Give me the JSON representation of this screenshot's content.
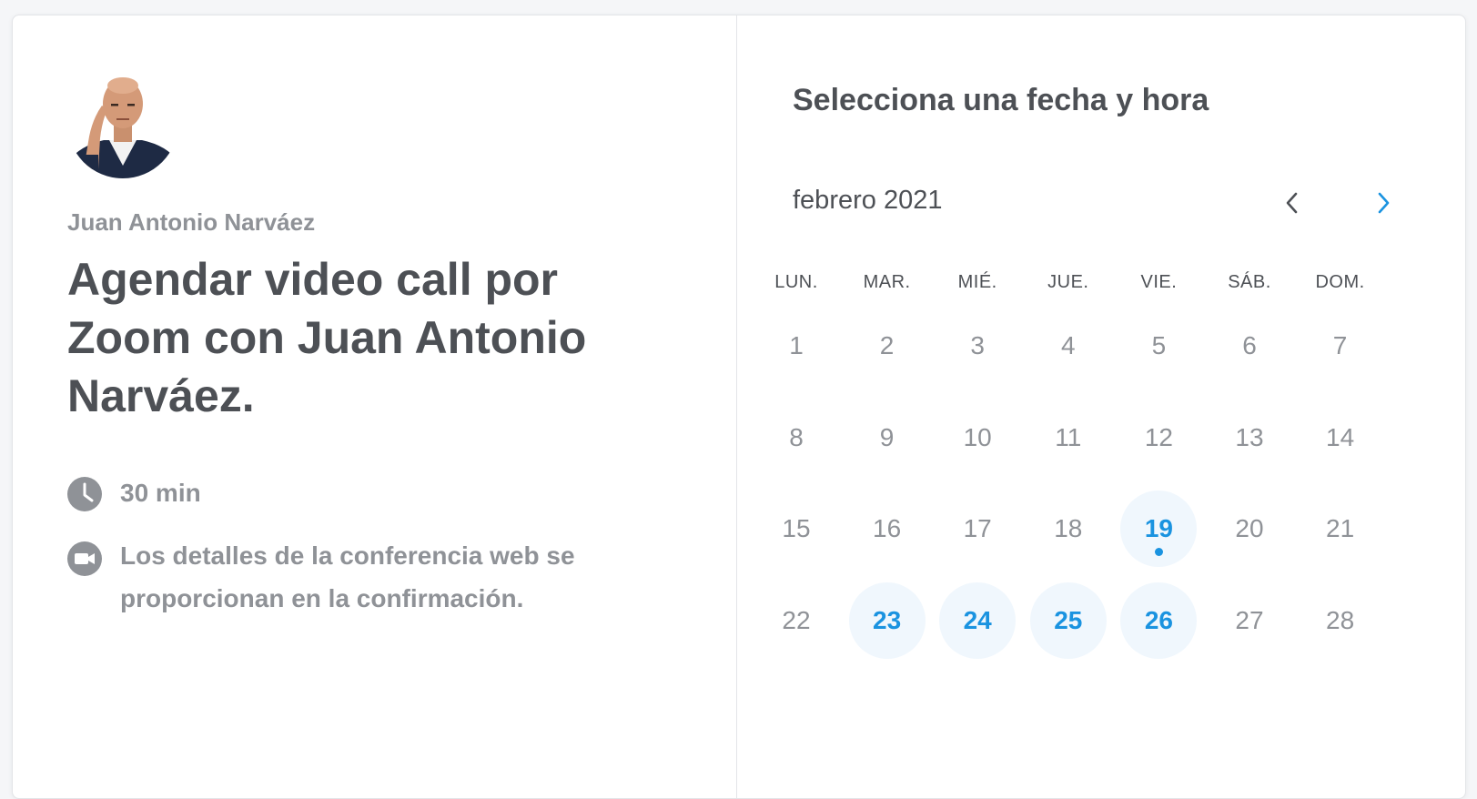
{
  "colors": {
    "accent": "#1a93e0",
    "available_bg": "#f0f7fd",
    "heading": "#4d5055",
    "muted": "#8f9297"
  },
  "host": {
    "name": "Juan Antonio Narváez",
    "avatar": "host-avatar-photo"
  },
  "event": {
    "title": "Agendar video call por Zoom con Juan Antonio Narváez.",
    "duration": "30 min",
    "duration_icon": "clock-icon",
    "conference": "Los detalles de la conferencia web se proporcionan en la confirmación.",
    "conference_icon": "video-camera-icon"
  },
  "picker": {
    "title": "Selecciona una fecha y hora",
    "month": "febrero 2021",
    "prev_icon": "chevron-left-icon",
    "next_icon": "chevron-right-icon",
    "weekdays": [
      "LUN.",
      "MAR.",
      "MIÉ.",
      "JUE.",
      "VIE.",
      "SÁB.",
      "DOM."
    ],
    "days": [
      {
        "label": "1",
        "available": false
      },
      {
        "label": "2",
        "available": false
      },
      {
        "label": "3",
        "available": false
      },
      {
        "label": "4",
        "available": false
      },
      {
        "label": "5",
        "available": false
      },
      {
        "label": "6",
        "available": false
      },
      {
        "label": "7",
        "available": false
      },
      {
        "label": "8",
        "available": false
      },
      {
        "label": "9",
        "available": false
      },
      {
        "label": "10",
        "available": false
      },
      {
        "label": "11",
        "available": false
      },
      {
        "label": "12",
        "available": false
      },
      {
        "label": "13",
        "available": false
      },
      {
        "label": "14",
        "available": false
      },
      {
        "label": "15",
        "available": false
      },
      {
        "label": "16",
        "available": false
      },
      {
        "label": "17",
        "available": false
      },
      {
        "label": "18",
        "available": false
      },
      {
        "label": "19",
        "available": true,
        "today": true
      },
      {
        "label": "20",
        "available": false
      },
      {
        "label": "21",
        "available": false
      },
      {
        "label": "22",
        "available": false
      },
      {
        "label": "23",
        "available": true
      },
      {
        "label": "24",
        "available": true
      },
      {
        "label": "25",
        "available": true
      },
      {
        "label": "26",
        "available": true
      },
      {
        "label": "27",
        "available": false
      },
      {
        "label": "28",
        "available": false
      }
    ]
  }
}
